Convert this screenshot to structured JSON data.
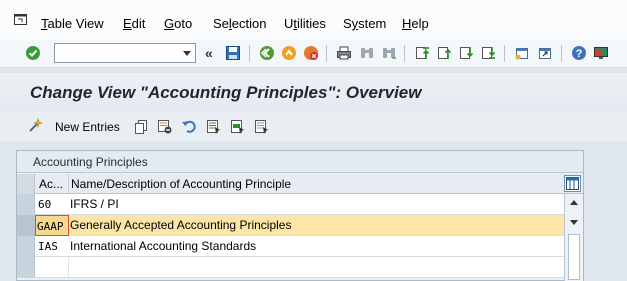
{
  "menu": {
    "items": [
      "Table View",
      "Edit",
      "Goto",
      "Selection",
      "Utilities",
      "System",
      "Help"
    ],
    "mnemonics": [
      "T",
      "E",
      "G",
      "l",
      "t",
      "y",
      "H"
    ]
  },
  "toolbar": {
    "command_field_value": "",
    "chevrons": "«",
    "icons": [
      "enter-check-icon",
      "save-icon",
      "back-icon",
      "exit-icon",
      "cancel-icon",
      "print-icon",
      "find-icon",
      "find-next-icon",
      "first-page-icon",
      "previous-page-icon",
      "next-page-icon",
      "last-page-icon",
      "create-session-icon",
      "shortcut-icon",
      "help-icon",
      "customize-layout-icon"
    ]
  },
  "title": "Change View \"Accounting Principles\": Overview",
  "app_toolbar": {
    "new_entries_label": "New Entries",
    "icons": [
      "copy-as-icon",
      "delete-icon",
      "undo-change-icon",
      "select-all-icon",
      "select-block-icon",
      "deselect-all-icon"
    ]
  },
  "table": {
    "caption": "Accounting Principles",
    "columns": [
      "Ac...",
      "Name/Description of Accounting Principle"
    ],
    "rows": [
      {
        "code": "60",
        "description": "IFRS / PI",
        "selected": false
      },
      {
        "code": "GAAP",
        "description": "Generally Accepted Accounting Principles",
        "selected": true
      },
      {
        "code": "IAS",
        "description": "International Accounting Standards",
        "selected": false
      },
      {
        "code": "",
        "description": "",
        "selected": false
      }
    ]
  },
  "colors": {
    "highlight_row": "#fbe6a8",
    "title_text": "#1d2733",
    "background": "#dfe6ee"
  }
}
